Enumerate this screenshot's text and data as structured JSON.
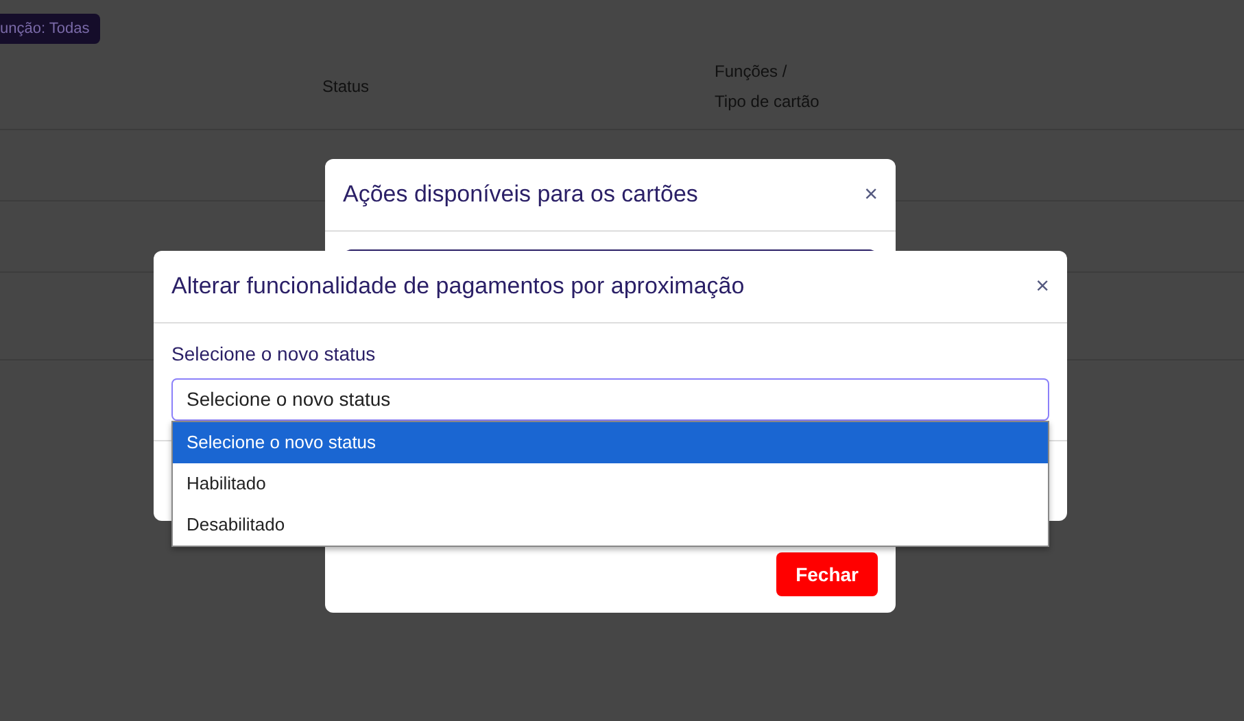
{
  "background": {
    "filter_badge": "unção: Todas",
    "columns": [
      {
        "lines": [
          "Status"
        ]
      },
      {
        "lines": [
          "Funções /",
          "Tipo de cartão"
        ]
      }
    ]
  },
  "actions_modal": {
    "title": "Ações disponíveis para os cartões",
    "close": "×",
    "close_button": "Fechar"
  },
  "status_modal": {
    "title": "Alterar funcionalidade de pagamentos por aproximação",
    "close": "×",
    "label": "Selecione o novo status",
    "select": {
      "value": "Selecione o novo status",
      "expanded": true,
      "options": [
        {
          "label": "Selecione o novo status",
          "selected": true
        },
        {
          "label": "Habilitado",
          "selected": false
        },
        {
          "label": "Desabilitado",
          "selected": false
        }
      ]
    }
  }
}
